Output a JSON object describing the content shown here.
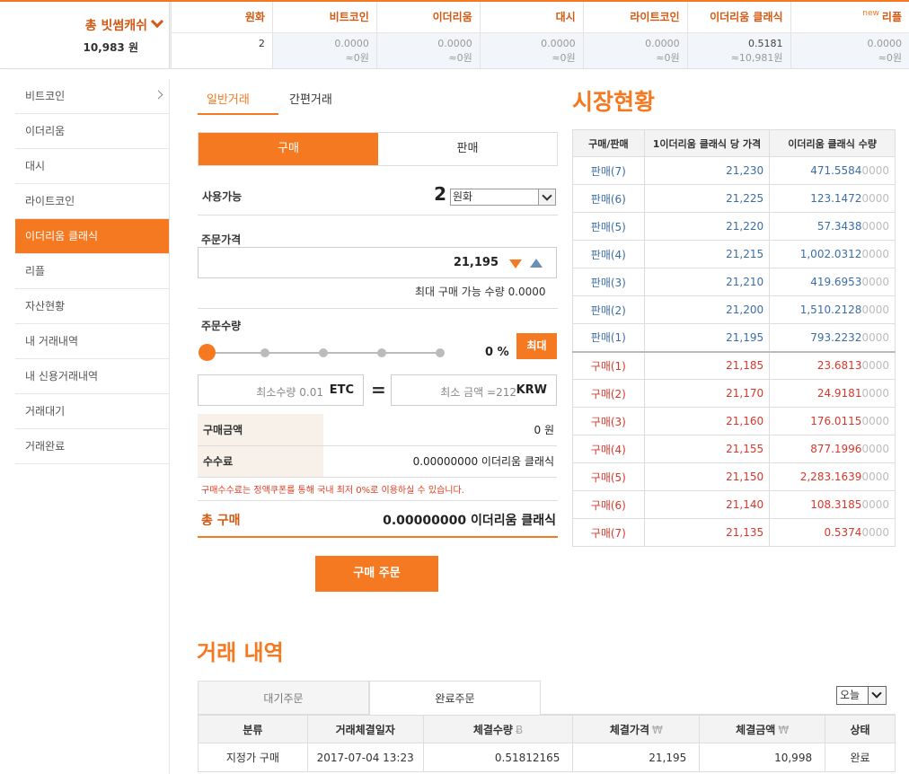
{
  "header": {
    "total_title": "총 빗썸캐쉬",
    "total_value": "10,983 원",
    "coins": [
      {
        "name": "원화",
        "amount": "2",
        "krw": "",
        "is_new": false
      },
      {
        "name": "비트코인",
        "amount": "0.0000",
        "krw": "≈0원",
        "is_new": false
      },
      {
        "name": "이더리움",
        "amount": "0.0000",
        "krw": "≈0원",
        "is_new": false
      },
      {
        "name": "대시",
        "amount": "0.0000",
        "krw": "≈0원",
        "is_new": false
      },
      {
        "name": "라이트코인",
        "amount": "0.0000",
        "krw": "≈0원",
        "is_new": false
      },
      {
        "name": "이더리움 클래식",
        "amount": "0.5181",
        "krw": "≈10,981원",
        "is_new": false
      },
      {
        "name": "리플",
        "amount": "0.0000",
        "krw": "≈0원",
        "is_new": true,
        "new_label": "new"
      }
    ]
  },
  "sidebar": {
    "items": [
      {
        "label": "비트코인",
        "active": false
      },
      {
        "label": "이더리움",
        "active": false
      },
      {
        "label": "대시",
        "active": false
      },
      {
        "label": "라이트코인",
        "active": false
      },
      {
        "label": "이더리움 클래식",
        "active": true
      },
      {
        "label": "리플",
        "active": false
      },
      {
        "label": "자산현황",
        "active": false
      },
      {
        "label": "내 거래내역",
        "active": false
      },
      {
        "label": "내 신용거래내역",
        "active": false
      },
      {
        "label": "거래대기",
        "active": false
      },
      {
        "label": "거래완료",
        "active": false
      }
    ]
  },
  "trade": {
    "tab_normal": "일반거래",
    "tab_simple": "간편거래",
    "buy_label": "구매",
    "sell_label": "판매",
    "available_label": "사용가능",
    "available_value": "2",
    "available_currency": "원화",
    "price_label": "주문가격",
    "price_value": "21,195",
    "max_buy": "최대 구매 가능 수량 0.0000",
    "qty_label": "주문수량",
    "percent": "0 %",
    "max_button": "최대",
    "min_qty_placeholder": "최소수량 0.01",
    "qty_unit": "ETC",
    "equals": "=",
    "min_amount_placeholder": "최소 금액 =212",
    "amount_unit": "KRW",
    "buy_amount_label": "구매금액",
    "buy_amount_value": "0 원",
    "fee_label": "수수료",
    "fee_value": "0.00000000 이더리움 클래식",
    "notice": "구매수수료는 정액쿠폰를 통해 국내 최저 0%로 이용하실 수 있습니다.",
    "total_label": "총 구매",
    "total_value": "0.00000000 이더리움 클래식",
    "order_button": "구매 주문"
  },
  "market": {
    "title": "시장현황",
    "headers": [
      "구매/판매",
      "1이더리움 클래식 당 가격",
      "이더리움 클래식 수량"
    ],
    "rows": [
      {
        "type": "판매(7)",
        "side": "sell",
        "price": "21,230",
        "qty": "471.5584",
        "zeros": "0000"
      },
      {
        "type": "판매(6)",
        "side": "sell",
        "price": "21,225",
        "qty": "123.1472",
        "zeros": "0000"
      },
      {
        "type": "판매(5)",
        "side": "sell",
        "price": "21,220",
        "qty": "57.3438",
        "zeros": "0000"
      },
      {
        "type": "판매(4)",
        "side": "sell",
        "price": "21,215",
        "qty": "1,002.0312",
        "zeros": "0000"
      },
      {
        "type": "판매(3)",
        "side": "sell",
        "price": "21,210",
        "qty": "419.6953",
        "zeros": "0000"
      },
      {
        "type": "판매(2)",
        "side": "sell",
        "price": "21,200",
        "qty": "1,510.2128",
        "zeros": "0000"
      },
      {
        "type": "판매(1)",
        "side": "sell",
        "price": "21,195",
        "qty": "793.2232",
        "zeros": "0000"
      },
      {
        "type": "구매(1)",
        "side": "buy",
        "price": "21,185",
        "qty": "23.6813",
        "zeros": "0000"
      },
      {
        "type": "구매(2)",
        "side": "buy",
        "price": "21,170",
        "qty": "24.9181",
        "zeros": "0000"
      },
      {
        "type": "구매(3)",
        "side": "buy",
        "price": "21,160",
        "qty": "176.0115",
        "zeros": "0000"
      },
      {
        "type": "구매(4)",
        "side": "buy",
        "price": "21,155",
        "qty": "877.1996",
        "zeros": "0000"
      },
      {
        "type": "구매(5)",
        "side": "buy",
        "price": "21,150",
        "qty": "2,283.1639",
        "zeros": "0000"
      },
      {
        "type": "구매(6)",
        "side": "buy",
        "price": "21,140",
        "qty": "108.3185",
        "zeros": "0000"
      },
      {
        "type": "구매(7)",
        "side": "buy",
        "price": "21,135",
        "qty": "0.5374",
        "zeros": "0000"
      }
    ]
  },
  "history": {
    "title": "거래 내역",
    "tab_pending": "대기주문",
    "tab_done": "완료주문",
    "period": "오늘",
    "headers": [
      "분류",
      "거래체결일자",
      "체결수량",
      "체결가격",
      "체결금액",
      "상태"
    ],
    "header_currency": {
      "qty": "Ƀ",
      "price": "₩",
      "amount": "₩"
    },
    "rows": [
      {
        "kind": "지정가 구매",
        "date": "2017-07-04 13:23",
        "qty": "0.51812165",
        "price": "21,195",
        "amount": "10,998",
        "status": "완료"
      }
    ]
  }
}
